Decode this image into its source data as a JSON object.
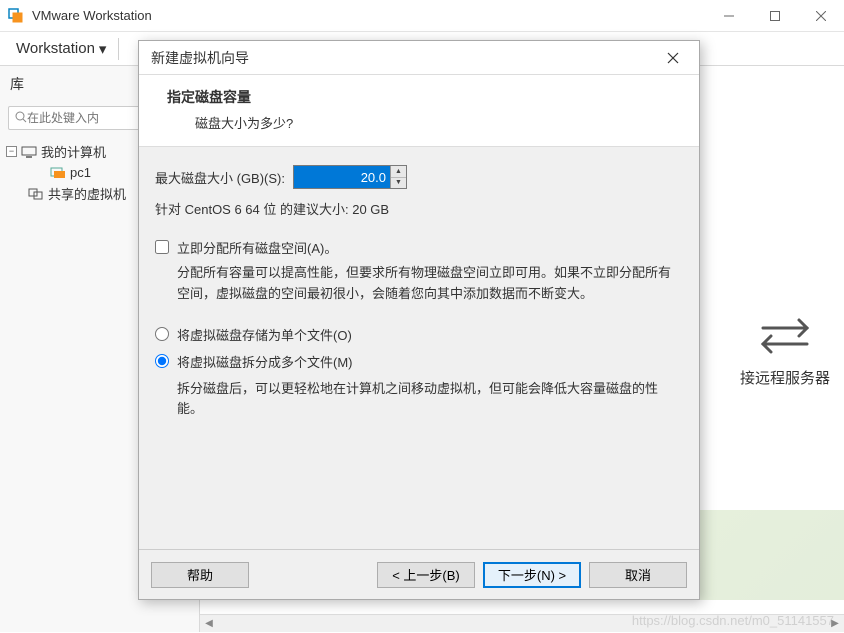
{
  "window": {
    "title": "VMware Workstation"
  },
  "menubar": {
    "workstation": "Workstation"
  },
  "sidebar": {
    "title": "库",
    "search_placeholder": "在此处键入内",
    "tree": {
      "root": "我的计算机",
      "items": [
        "pc1",
        "共享的虚拟机"
      ]
    }
  },
  "main": {
    "remote_label": "接远程服务器"
  },
  "dialog": {
    "title": "新建虚拟机向导",
    "heading": "指定磁盘容量",
    "subheading": "磁盘大小为多少?",
    "max_size_label": "最大磁盘大小 (GB)(S):",
    "max_size_value": "20.0",
    "recommend": "针对 CentOS 6 64 位 的建议大小: 20 GB",
    "alloc_now_label": "立即分配所有磁盘空间(A)。",
    "alloc_desc": "分配所有容量可以提高性能，但要求所有物理磁盘空间立即可用。如果不立即分配所有空间，虚拟磁盘的空间最初很小，会随着您向其中添加数据而不断变大。",
    "radio_single": "将虚拟磁盘存储为单个文件(O)",
    "radio_split": "将虚拟磁盘拆分成多个文件(M)",
    "split_desc": "拆分磁盘后，可以更轻松地在计算机之间移动虚拟机，但可能会降低大容量磁盘的性能。",
    "buttons": {
      "help": "帮助",
      "back": "< 上一步(B)",
      "next": "下一步(N) >",
      "cancel": "取消"
    }
  },
  "watermark": "https://blog.csdn.net/m0_51141557"
}
